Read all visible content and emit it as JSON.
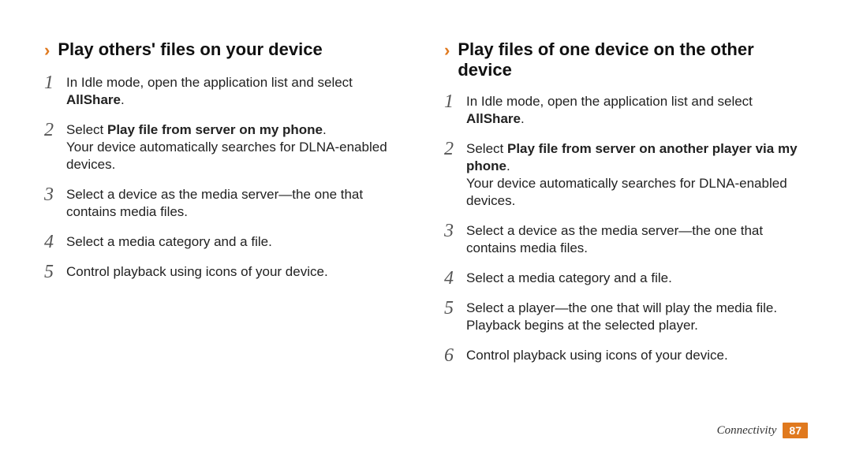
{
  "left": {
    "heading": "Play others' files on your device",
    "steps": [
      {
        "num": "1",
        "pre": "In Idle mode, open the application list and select ",
        "bold": "AllShare",
        "post": "."
      },
      {
        "num": "2",
        "pre": "Select ",
        "bold": "Play file from server on my phone",
        "post": ".",
        "sub": "Your device automatically searches for DLNA-enabled devices."
      },
      {
        "num": "3",
        "pre": "Select a device as the media server—the one that contains media files.",
        "bold": "",
        "post": ""
      },
      {
        "num": "4",
        "pre": "Select a media category and a file.",
        "bold": "",
        "post": ""
      },
      {
        "num": "5",
        "pre": "Control playback using icons of your device.",
        "bold": "",
        "post": ""
      }
    ]
  },
  "right": {
    "heading": "Play files of one device on the other device",
    "steps": [
      {
        "num": "1",
        "pre": "In Idle mode, open the application list and select ",
        "bold": "AllShare",
        "post": "."
      },
      {
        "num": "2",
        "pre": "Select ",
        "bold": "Play file from server on another player via my phone",
        "post": ".",
        "sub": "Your device automatically searches for DLNA-enabled devices."
      },
      {
        "num": "3",
        "pre": "Select a device as the media server—the one that contains media files.",
        "bold": "",
        "post": ""
      },
      {
        "num": "4",
        "pre": "Select a media category and a file.",
        "bold": "",
        "post": ""
      },
      {
        "num": "5",
        "pre": "Select a player—the one that will play the media file. Playback begins at the selected player.",
        "bold": "",
        "post": ""
      },
      {
        "num": "6",
        "pre": "Control playback using icons of your device.",
        "bold": "",
        "post": ""
      }
    ]
  },
  "footer": {
    "section": "Connectivity",
    "page": "87"
  },
  "chevron": "›"
}
